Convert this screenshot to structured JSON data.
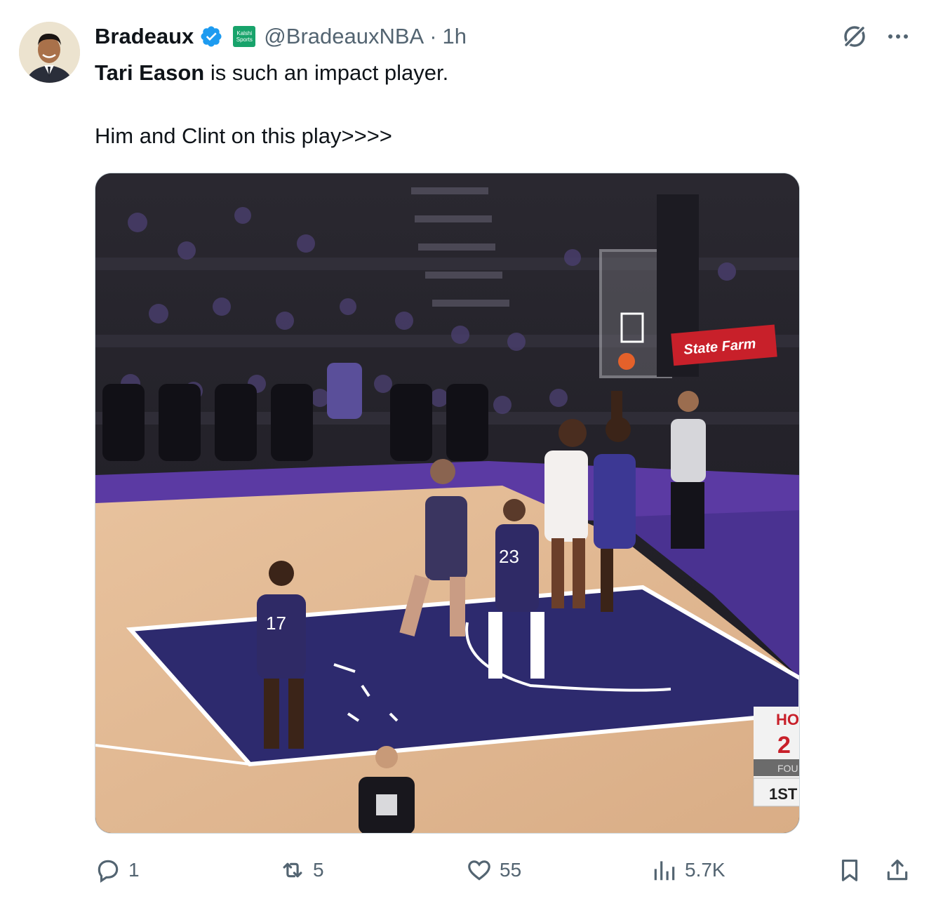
{
  "author": {
    "display_name": "Bradeaux",
    "verified_icon": "verified-badge-icon",
    "affiliation_label": "Kalshi Sports",
    "handle": "@BradeauxNBA",
    "separator": "·",
    "time": "1h"
  },
  "tweet": {
    "bold_text": "Tari Eason",
    "line1_rest": " is such an impact player.",
    "line2": "Him and Clint on this play>>>>"
  },
  "header_icons": {
    "grok": "grok-icon",
    "more": "more-icon"
  },
  "media": {
    "banner_text": "State Farm",
    "jersey_17": "17",
    "jersey_23": "23",
    "scoreboard": {
      "team": "HO",
      "score": "2",
      "quarter": "1ST",
      "sub": "FOU"
    }
  },
  "actions": {
    "replies": "1",
    "reposts": "5",
    "likes": "55",
    "views": "5.7K"
  },
  "colors": {
    "verified": "#1d9bf0",
    "affiliation": "#18a36b",
    "secondary_text": "#536471",
    "court_purple": "#5b3aa3",
    "paint": "#2d2a6e"
  }
}
